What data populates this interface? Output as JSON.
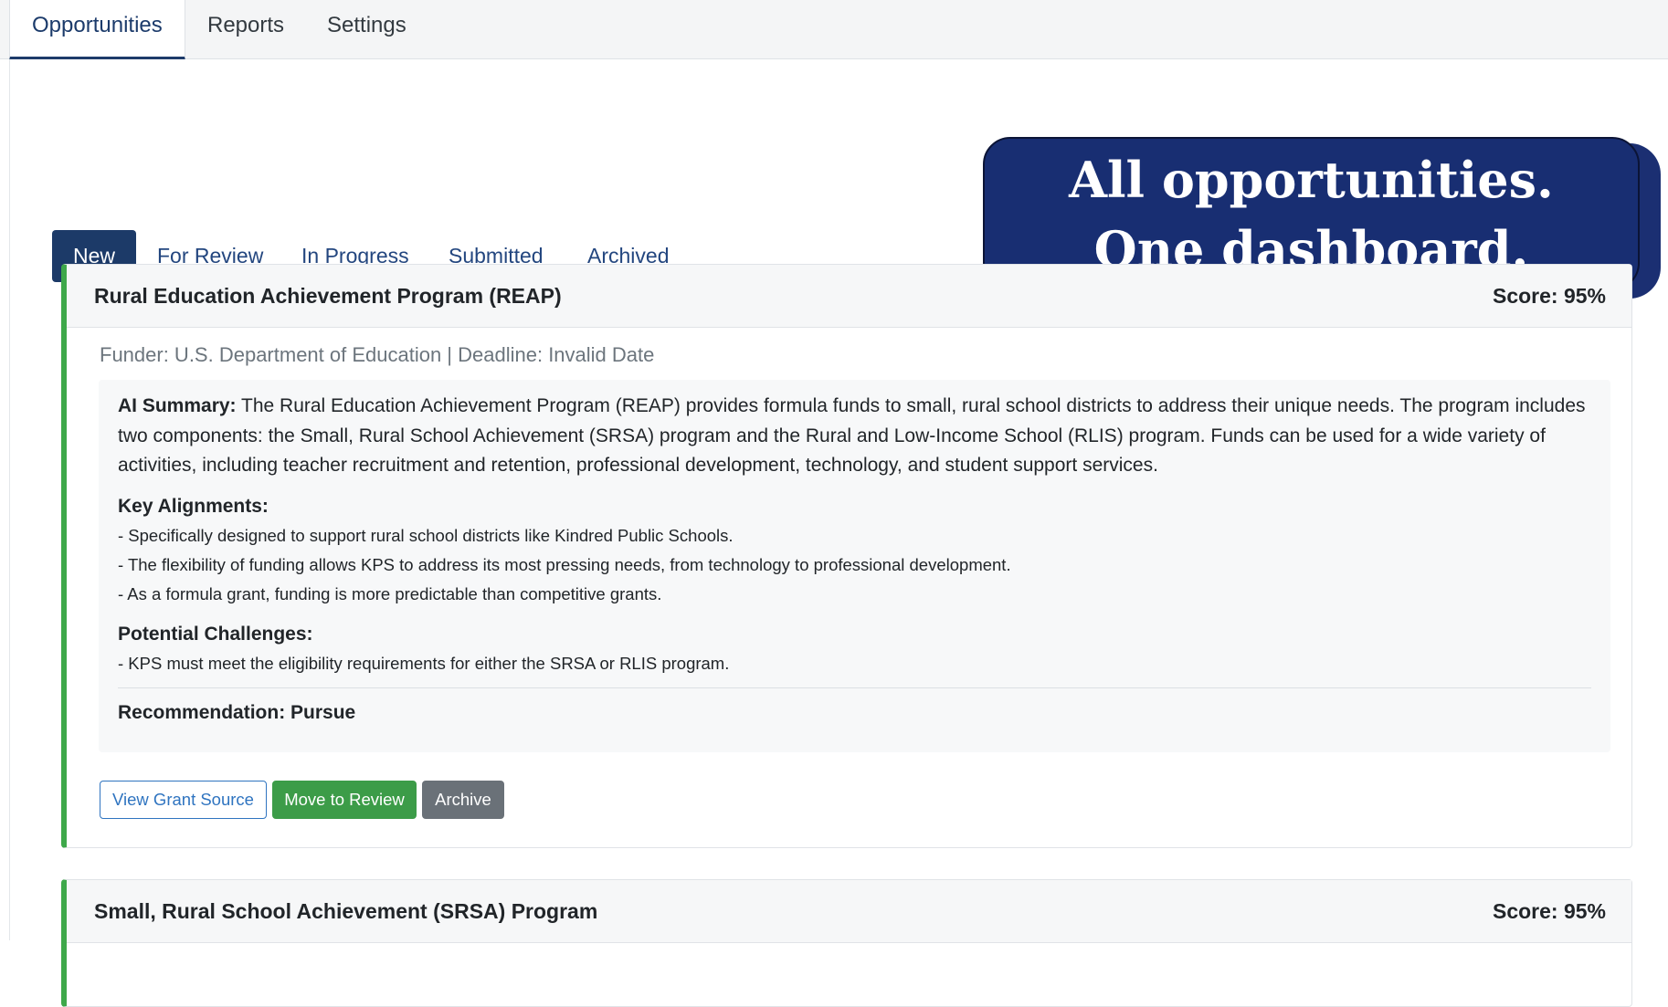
{
  "nav": {
    "tabs": [
      {
        "label": "Opportunities",
        "active": true
      },
      {
        "label": "Reports",
        "active": false
      },
      {
        "label": "Settings",
        "active": false
      }
    ]
  },
  "status_tabs": [
    {
      "label": "New",
      "active": true
    },
    {
      "label": "For Review",
      "active": false
    },
    {
      "label": "In Progress",
      "active": false
    },
    {
      "label": "Submitted",
      "active": false
    },
    {
      "label": "Archived",
      "active": false
    }
  ],
  "banner": {
    "line1": "All opportunities.",
    "line2": "One dashboard."
  },
  "cards": [
    {
      "title": "Rural Education Achievement Program (REAP)",
      "score": "Score: 95%",
      "meta": "Funder: U.S. Department of Education | Deadline: Invalid Date",
      "summary_label": "AI Summary:",
      "summary": "The Rural Education Achievement Program (REAP) provides formula funds to small, rural school districts to address their unique needs. The program includes two components: the Small, Rural School Achievement (SRSA) program and the Rural and Low-Income School (RLIS) program. Funds can be used for a wide variety of activities, including teacher recruitment and retention, professional development, technology, and student support services.",
      "alignments_heading": "Key Alignments:",
      "alignments": [
        "- Specifically designed to support rural school districts like Kindred Public Schools.",
        "- The flexibility of funding allows KPS to address its most pressing needs, from technology to professional development.",
        "- As a formula grant, funding is more predictable than competitive grants."
      ],
      "challenges_heading": "Potential Challenges:",
      "challenges": [
        "- KPS must meet the eligibility requirements for either the SRSA or RLIS program."
      ],
      "recommendation": "Recommendation: Pursue",
      "buttons": {
        "view": "View Grant Source",
        "move": "Move to Review",
        "archive": "Archive"
      }
    },
    {
      "title": "Small, Rural School Achievement (SRSA) Program",
      "score": "Score: 95%"
    }
  ],
  "colors": {
    "primary": "#1c3a68",
    "accent_green": "#3ea84a",
    "link_blue": "#2f74c0",
    "banner_bg": "#182e72"
  }
}
